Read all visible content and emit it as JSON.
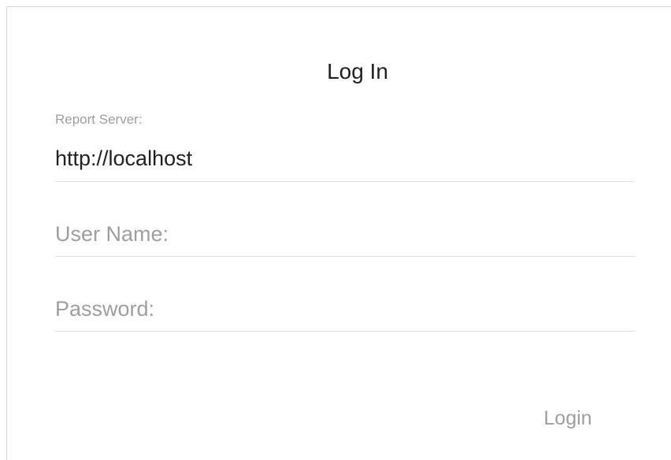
{
  "dialog": {
    "title": "Log In",
    "report_server": {
      "label": "Report Server:",
      "value": "http://localhost"
    },
    "user_name": {
      "placeholder": "User Name:",
      "value": ""
    },
    "password": {
      "placeholder": "Password:",
      "value": ""
    },
    "login_label": "Login"
  },
  "colors": {
    "text_primary": "#212121",
    "text_hint": "#9e9e9e",
    "divider": "#dedede"
  }
}
